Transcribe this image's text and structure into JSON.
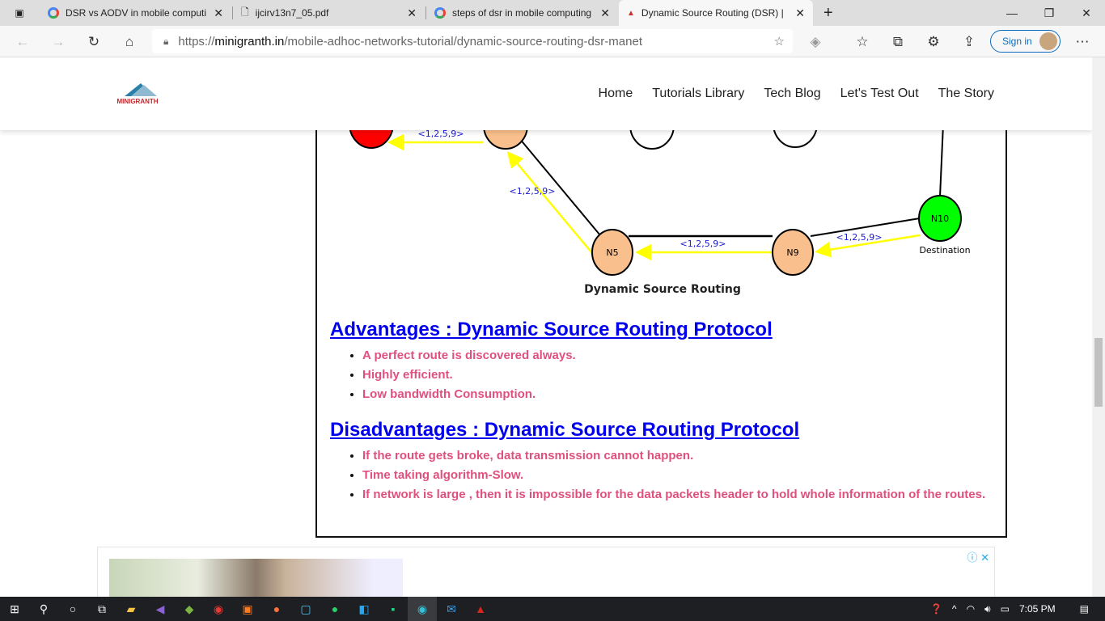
{
  "browser": {
    "tabs": [
      {
        "title": "DSR vs AODV in mobile computi",
        "icon": "google-icon"
      },
      {
        "title": "ijcirv13n7_05.pdf",
        "icon": "document-icon"
      },
      {
        "title": "steps of dsr in mobile computing",
        "icon": "google-icon"
      },
      {
        "title": "Dynamic Source Routing (DSR) |",
        "icon": "site-icon",
        "active": true
      }
    ],
    "url_prefix": "https://",
    "url_domain": "minigranth.in",
    "url_path": "/mobile-adhoc-networks-tutorial/dynamic-source-routing-dsr-manet",
    "sign_in": "Sign in"
  },
  "site": {
    "logo_text": "MINIGRANTH",
    "nav": [
      "Home",
      "Tutorials Library",
      "Tech Blog",
      "Let's Test Out",
      "The Story"
    ]
  },
  "diagram": {
    "route_label": "<1,2,5,9>",
    "nodes": {
      "n5": "N5",
      "n9": "N9",
      "n10": "N10"
    },
    "destination": "Destination",
    "caption": "Dynamic Source Routing",
    "colors": {
      "source": "#ff0000",
      "route": "#f9bf8c",
      "destination": "#00ff00",
      "arrow": "#ffff00"
    }
  },
  "advantages": {
    "heading": "Advantages : Dynamic Source Routing Protocol",
    "items": [
      "A perfect route is discovered always.",
      "Highly efficient.",
      "Low bandwidth Consumption."
    ]
  },
  "disadvantages": {
    "heading": "Disadvantages : Dynamic Source Routing Protocol",
    "items": [
      "If the route gets broke, data transmission cannot happen.",
      "Time taking algorithm-Slow.",
      "If network is large , then it is impossible for the data packets header to hold whole information of the routes."
    ]
  },
  "taskbar": {
    "time": "7:05 PM"
  }
}
